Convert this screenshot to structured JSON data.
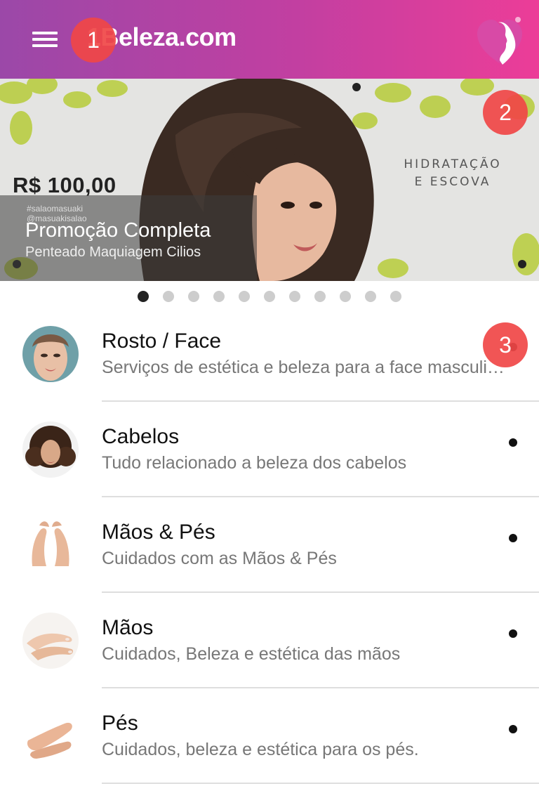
{
  "appbar": {
    "title": "1Beleza.com",
    "menu_icon": "hamburger-menu-icon",
    "logo_icon": "woman-profile-logo-icon"
  },
  "banner": {
    "price": "R$ 100,00",
    "side_text_line1": "HIDRATAÇÃO",
    "side_text_line2": "E ESCOVA",
    "handle_line1": "#salaomasuaki",
    "handle_line2": "@masuakisalao",
    "title": "Promoção Completa",
    "subtitle": "Penteado Maquiagem Cilios"
  },
  "indicator": {
    "count": 11,
    "active_index": 0
  },
  "list": {
    "items": [
      {
        "title": "Rosto / Face",
        "subtitle": "Serviços de estética e beleza para a face masculina e feminina"
      },
      {
        "title": "Cabelos",
        "subtitle": "Tudo relacionado a beleza dos cabelos"
      },
      {
        "title": "Mãos & Pés",
        "subtitle": "Cuidados com as Mãos & Pés"
      },
      {
        "title": "Mãos",
        "subtitle": "Cuidados, Beleza e estética das mãos"
      },
      {
        "title": "Pés",
        "subtitle": "Cuidados, beleza e estética para os pés."
      }
    ]
  },
  "markers": [
    "1",
    "2",
    "3"
  ],
  "colors": {
    "appbar_start": "#9b48a8",
    "appbar_end": "#ec3d98",
    "marker": "#f04646",
    "active_dot": "#222222",
    "inactive_dot": "#cdcdcd"
  }
}
